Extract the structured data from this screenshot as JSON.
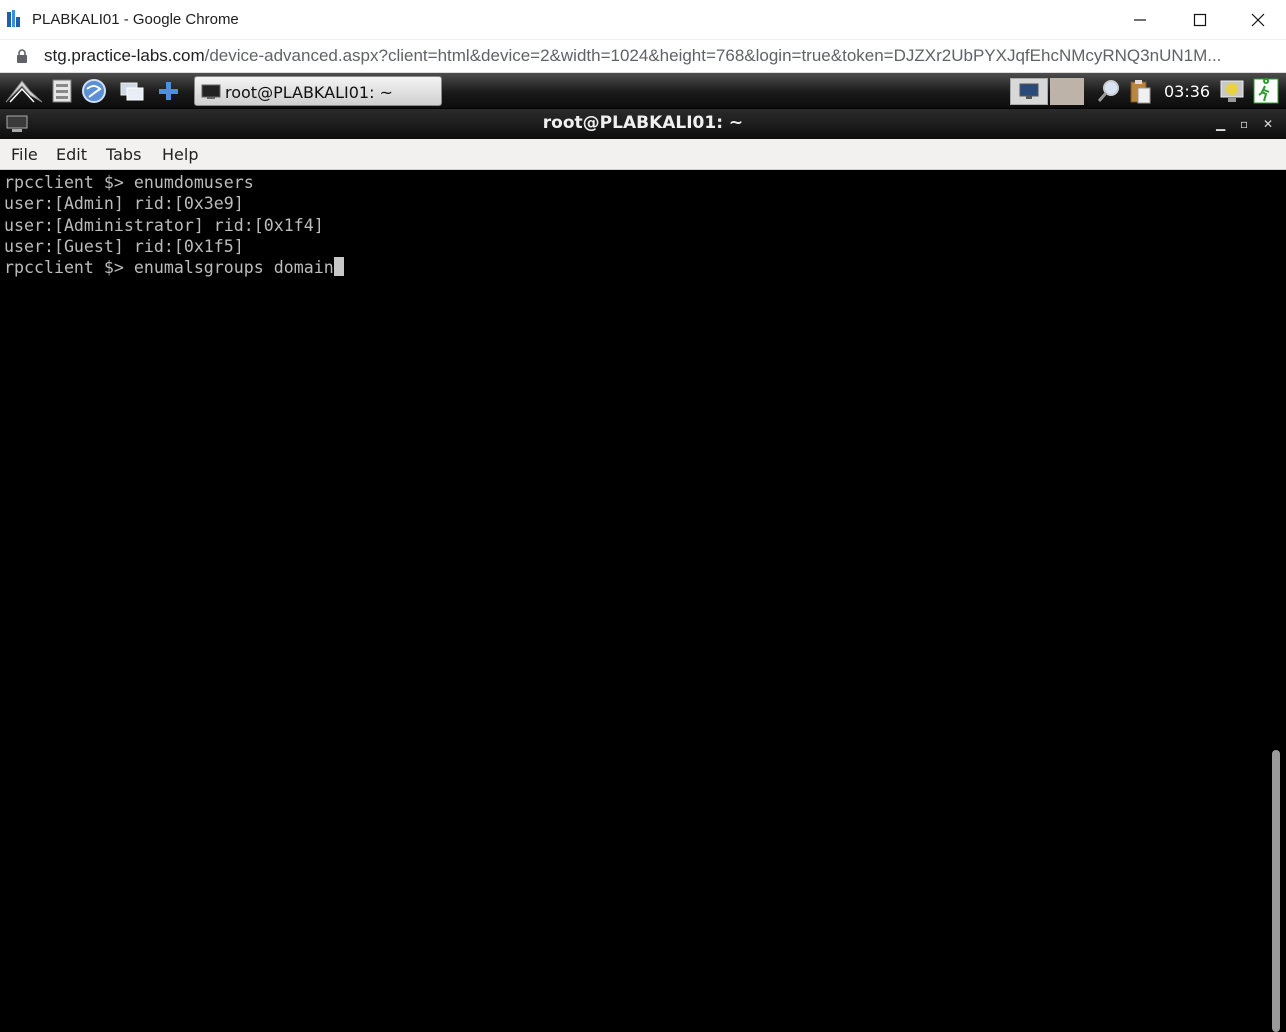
{
  "browser": {
    "window_title": "PLABKALI01 - Google Chrome",
    "url_host": "stg.practice-labs.com",
    "url_rest": "/device-advanced.aspx?client=html&device=2&width=1024&height=768&login=true&token=DJZXr2UbPYXJqfEhcNMcyRNQ3nUN1M..."
  },
  "panel": {
    "taskbar_window_label": "root@PLABKALI01: ~",
    "clock": "03:36",
    "launcher_icons": [
      "lxde-menu-icon",
      "file-manager-icon",
      "web-browser-icon",
      "show-desktop-icon",
      "add-icon"
    ]
  },
  "terminal": {
    "title": "root@PLABKALI01: ~",
    "menu": [
      "File",
      "Edit",
      "Tabs",
      "Help"
    ],
    "lines": [
      "rpcclient $> enumdomusers",
      "user:[Admin] rid:[0x3e9]",
      "user:[Administrator] rid:[0x1f4]",
      "user:[Guest] rid:[0x1f5]",
      "rpcclient $> enumalsgroups domain"
    ]
  }
}
